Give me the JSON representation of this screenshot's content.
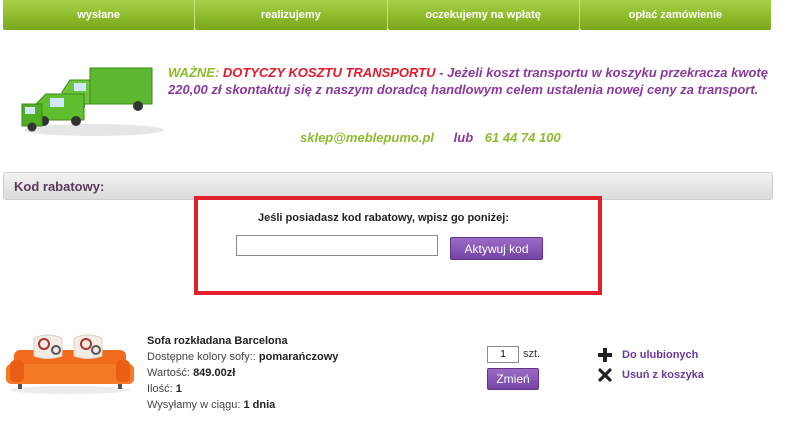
{
  "tabs": [
    "wysłane",
    "realizujemy",
    "oczekujemy na wpłatę",
    "opłać zamówienie"
  ],
  "notice": {
    "prefix": "WAŻNE:",
    "highlight": "DOTYCZY KOSZTU TRANSPORTU",
    "body": "- Jeżeli koszt transportu w koszyku przekracza kwotę 220,00 zł skontaktuj się z naszym doradcą handlowym celem ustalenia nowej ceny za transport."
  },
  "contact": {
    "email": "sklep@meblepumo.pl",
    "separator": "lub",
    "phone": "61 44 74 100"
  },
  "discount": {
    "title": "Kod rabatowy:",
    "prompt": "Jeśli posiadasz kod rabatowy, wpisz go poniżej:",
    "input_value": "",
    "button": "Aktywuj kod"
  },
  "product": {
    "name": "Sofa rozkładana Barcelona",
    "color_label": "Dostępne kolory sofy::",
    "color_value": "pomarańczowy",
    "value_label": "Wartość:",
    "value": "849.00zł",
    "qty_label": "Ilość:",
    "qty_value": "1",
    "ship_label": "Wysyłamy w ciągu:",
    "ship_value": "1 dnia",
    "quantity_input": "1",
    "unit": "szt.",
    "change_button": "Zmień",
    "favorite_link": "Do ulubionych",
    "remove_link": "Usuń z koszyka"
  },
  "colors": {
    "tab_green": "#8dbb2a",
    "purple": "#8a3a9c",
    "red": "#e41f2c",
    "button_purple": "#7443a6"
  }
}
